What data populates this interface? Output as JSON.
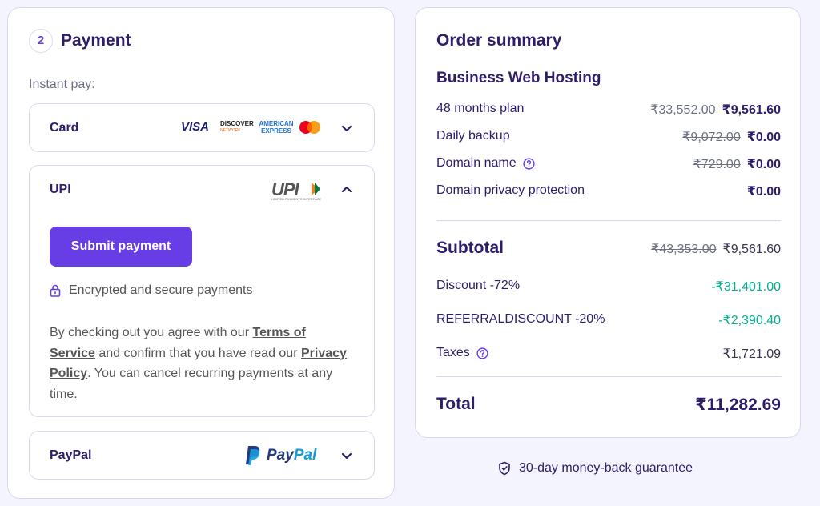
{
  "payment": {
    "step_number": "2",
    "title": "Payment",
    "instant_pay_label": "Instant pay:",
    "methods": {
      "card": {
        "label": "Card",
        "logos": [
          "VISA",
          "DISCOVER",
          "AMERICAN EXPRESS",
          "mastercard"
        ]
      },
      "upi": {
        "label": "UPI",
        "logo_text": "UPI",
        "logo_tagline": "UNIFIED PAYMENTS INTERFACE",
        "submit_label": "Submit payment",
        "secure_text": "Encrypted and secure payments",
        "terms_prefix": "By checking out you agree with our ",
        "terms_link": "Terms of Service",
        "terms_middle": " and confirm that you have read our ",
        "privacy_link": "Privacy Policy",
        "terms_suffix": ". You can cancel recurring payments at any time."
      },
      "paypal": {
        "label": "PayPal",
        "logo_part1": "Pay",
        "logo_part2": "Pal"
      }
    }
  },
  "order_summary": {
    "title": "Order summary",
    "product": "Business Web Hosting",
    "lines": [
      {
        "label": "48 months plan",
        "old_price": "₹33,552.00",
        "price": "₹9,561.60"
      },
      {
        "label": "Daily backup",
        "old_price": "₹9,072.00",
        "price": "₹0.00"
      },
      {
        "label": "Domain name",
        "old_price": "₹729.00",
        "price": "₹0.00"
      },
      {
        "label": "Domain privacy protection",
        "price": "₹0.00"
      }
    ],
    "subtotal": {
      "label": "Subtotal",
      "old_price": "₹43,353.00",
      "price": "₹9,561.60"
    },
    "discount": {
      "label": "Discount -72%",
      "value": "-₹31,401.00"
    },
    "referral": {
      "label": "REFERRALDISCOUNT -20%",
      "value": "-₹2,390.40"
    },
    "taxes": {
      "label": "Taxes",
      "value": "₹1,721.09"
    },
    "total": {
      "label": "Total",
      "value": "₹11,282.69"
    }
  },
  "guarantee": "30-day money-back guarantee",
  "colors": {
    "primary": "#673de6",
    "heading": "#2f1c6a",
    "discount": "#00b090",
    "background": "#f4f4fe"
  }
}
